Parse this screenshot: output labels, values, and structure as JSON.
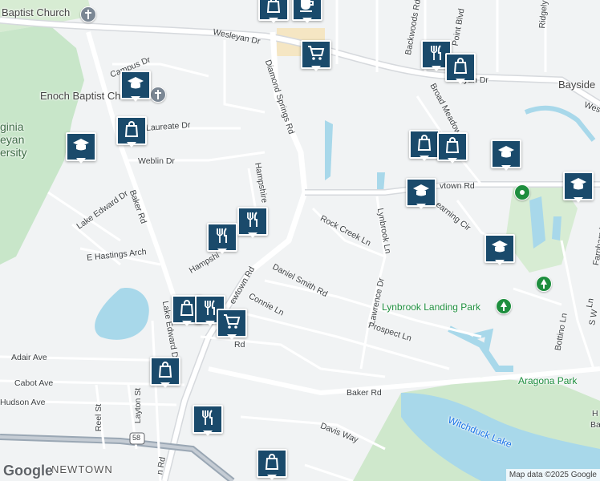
{
  "map": {
    "attribution": "Map data ©2025 Google",
    "logo": "Google",
    "colors": {
      "water": "#a8d8ea",
      "park": "#c8e6c9",
      "road": "#ffffff",
      "major_road": "#d6d9dd",
      "land": "#f1f3f4",
      "pin": "#1a4a6b"
    }
  },
  "labels": {
    "baptist_church": "Baptist Church",
    "enoch_baptist": "Enoch Baptist Ch",
    "virginia_wesleyan": "ginia",
    "virginia_wesleyan2": "eyan",
    "virginia_wesleyan3": "ersity",
    "wesleyan_dr_w": "Wesleyan Dr",
    "wesleyan_dr_e": "yan Dr",
    "bayside": "Bayside",
    "we_right": "Wes",
    "diamond_springs": "Diamond Springs Rd",
    "backwoods": "Backwoods Rd",
    "point_blvd": "Point Blvd",
    "ridgely": "Ridgely",
    "campus_dr": "Campus Dr",
    "laureate": "Laureate Dr",
    "weblin": "Weblin Dr",
    "broad_meadow": "Broad Meadow",
    "hampshire_top": "Hampshire",
    "newtown_rd_top": "vtown Rd",
    "learning_cir": "Learning Cir",
    "baker_rd_top": "Baker Rd",
    "lake_edward_top": "Lake Edward Dr",
    "rock_creek": "Rock Creek Ln",
    "lynbrook": "Lynbrook Ln",
    "e_hastings": "E Hastings Arch",
    "hampshire_bot": "Hampshi",
    "newtown_rd_mid": "ewtown Rd",
    "daniel_smith": "Daniel Smith Rd",
    "farnham": "Farnham L",
    "lawrence": "Lawrence Dr",
    "lynbrook_landing": "Lynbrook Landing Park",
    "connie": "Connie Ln",
    "prospect": "Prospect Ln",
    "lake_edward_bot": "Lake Edward D",
    "bottino": "Bottino Ln",
    "s_w": "S W",
    "adair": "Adair Ave",
    "rd_small": "Rd",
    "aragona_park": "Aragona Park",
    "cabot": "Cabot Ave",
    "baker_rd_bot": "Baker Rd",
    "hudson": "Hudson Ave",
    "reel_st": "Reel St",
    "layton_st": "Layton St",
    "witchduck_lake": "Witchduck Lake",
    "davis_way": "Davis Way",
    "newtown_area": "NEWTOWN",
    "route_58": "58",
    "newtown_bot": "n Rd",
    "h_right": "H",
    "ba_right": "Ba",
    "ln_right": "Ln"
  },
  "pins": [
    {
      "icon": "shopping-bag-icon"
    },
    {
      "icon": "coffee-icon"
    },
    {
      "icon": "shopping-cart-icon"
    },
    {
      "icon": "restaurant-icon"
    },
    {
      "icon": "shopping-bag-icon"
    },
    {
      "icon": "school-icon"
    },
    {
      "icon": "shopping-bag-icon"
    },
    {
      "icon": "school-icon"
    },
    {
      "icon": "shopping-bag-icon"
    },
    {
      "icon": "shopping-bag-icon"
    },
    {
      "icon": "school-icon"
    },
    {
      "icon": "school-icon"
    },
    {
      "icon": "school-icon"
    },
    {
      "icon": "restaurant-icon"
    },
    {
      "icon": "restaurant-icon"
    },
    {
      "icon": "school-icon"
    },
    {
      "icon": "shopping-bag-icon"
    },
    {
      "icon": "restaurant-icon"
    },
    {
      "icon": "shopping-cart-icon"
    },
    {
      "icon": "shopping-bag-icon"
    },
    {
      "icon": "restaurant-icon"
    },
    {
      "icon": "shopping-bag-icon"
    }
  ]
}
